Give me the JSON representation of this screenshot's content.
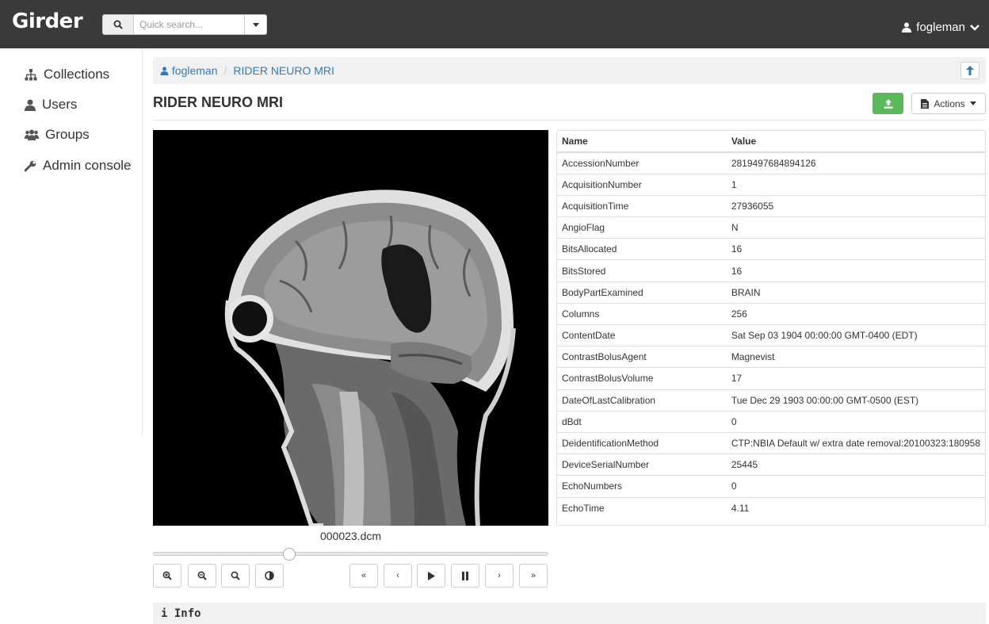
{
  "header": {
    "brand": "Girder",
    "search_placeholder": "Quick search...",
    "user": "fogleman"
  },
  "sidebar": {
    "items": [
      {
        "label": "Collections",
        "icon": "sitemap-icon"
      },
      {
        "label": "Users",
        "icon": "user-icon"
      },
      {
        "label": "Groups",
        "icon": "users-icon"
      },
      {
        "label": "Admin console",
        "icon": "wrench-icon"
      }
    ]
  },
  "breadcrumb": {
    "user": "fogleman",
    "folder": "RIDER NEURO MRI"
  },
  "page": {
    "title": "RIDER NEURO MRI",
    "actions_label": "Actions"
  },
  "viewer": {
    "filename": "000023.dcm",
    "slider_fraction": 0.345,
    "controls": [
      "zoom-in-icon",
      "zoom-out-icon",
      "zoom-reset-icon",
      "contrast-icon",
      "first-icon",
      "previous-icon",
      "play-icon",
      "pause-icon",
      "next-icon",
      "last-icon"
    ]
  },
  "table": {
    "headers": [
      "Name",
      "Value"
    ],
    "rows": [
      [
        "AccessionNumber",
        "2819497684894126"
      ],
      [
        "AcquisitionNumber",
        "1"
      ],
      [
        "AcquisitionTime",
        "27936055"
      ],
      [
        "AngioFlag",
        "N"
      ],
      [
        "BitsAllocated",
        "16"
      ],
      [
        "BitsStored",
        "16"
      ],
      [
        "BodyPartExamined",
        "BRAIN"
      ],
      [
        "Columns",
        "256"
      ],
      [
        "ContentDate",
        "Sat Sep 03 1904 00:00:00 GMT-0400 (EDT)"
      ],
      [
        "ContrastBolusAgent",
        "Magnevist"
      ],
      [
        "ContrastBolusVolume",
        "17"
      ],
      [
        "DateOfLastCalibration",
        "Tue Dec 29 1903 00:00:00 GMT-0500 (EST)"
      ],
      [
        "dBdt",
        "0"
      ],
      [
        "DeidentificationMethod",
        "CTP:NBIA Default w/ extra date removal:20100323:180958"
      ],
      [
        "DeviceSerialNumber",
        "25445"
      ],
      [
        "EchoNumbers",
        "0"
      ],
      [
        "EchoTime",
        "4.11"
      ]
    ]
  },
  "info": {
    "title": "Info"
  },
  "colors": {
    "topbar": "#3a3a3a",
    "link": "#337ab7",
    "upload": "#5cb85c"
  }
}
